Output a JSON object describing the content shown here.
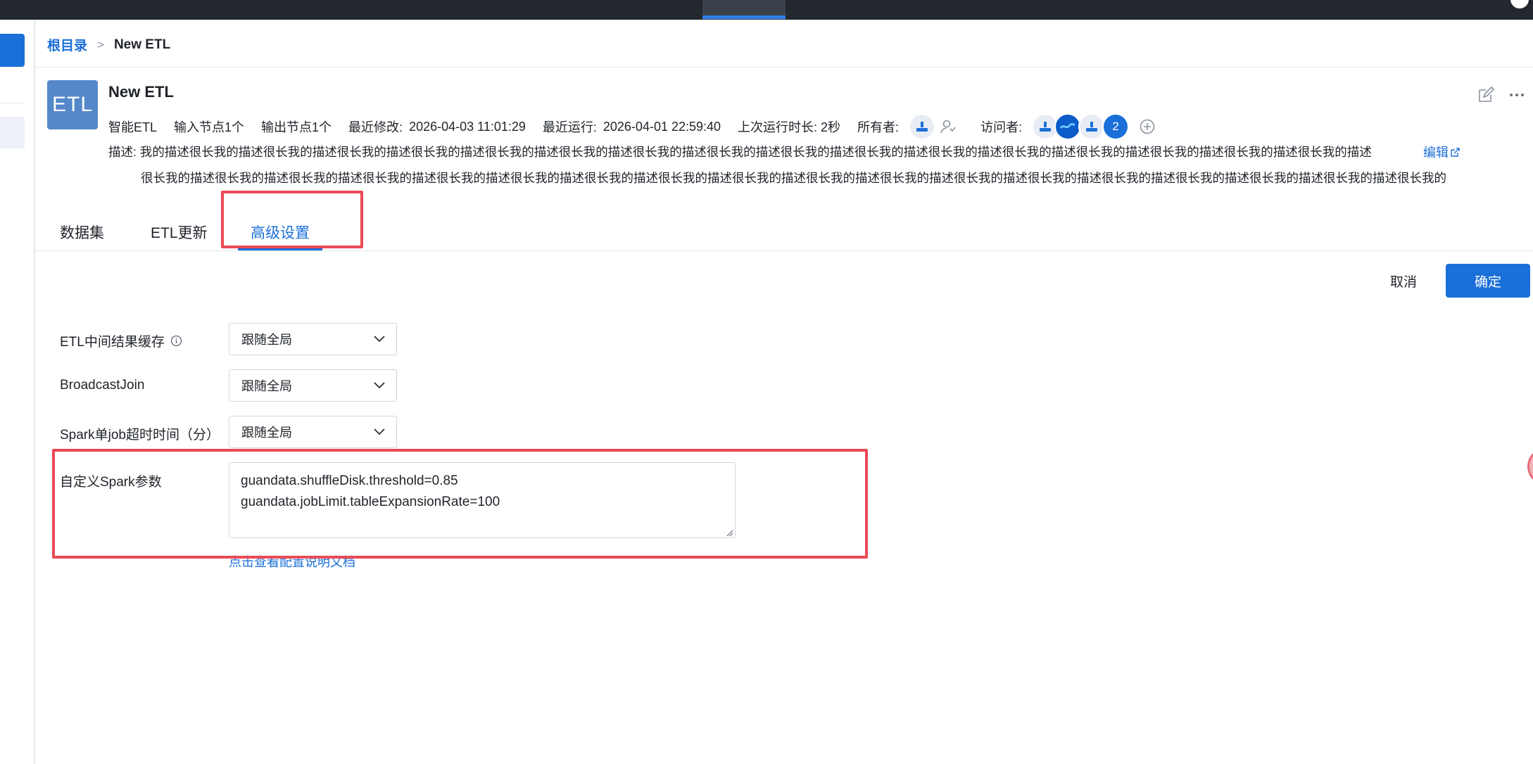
{
  "breadcrumb": {
    "root": "根目录",
    "separator": ">",
    "current": "New ETL"
  },
  "etl": {
    "logo_text": "ETL",
    "title": "New ETL",
    "meta": {
      "type": "智能ETL",
      "inputs": "输入节点1个",
      "outputs": "输出节点1个",
      "modified_label": "最近修改:",
      "modified_value": "2026-04-03 11:01:29",
      "run_label": "最近运行:",
      "run_value": "2026-04-01 22:59:40",
      "duration": "上次运行时长: 2秒",
      "owner_label": "所有者:",
      "visitor_label": "访问者:",
      "visitor_more_count": "2"
    },
    "description_line1": "描述: 我的描述很长我的描述很长我的描述很长我的描述很长我的描述很长我的描述很长我的描述很长我的描述很长我的描述很长我的描述很长我的描述很长我的描述很长我的描述很长我的描述很长我的描述很长我的描述很长我的描述",
    "description_line2": "很长我的描述很长我的描述很长我的描述很长我的描述很长我的描述很长我的描述很长我的描述很长我的描述很长我的描述很长我的描述很长我的描述很长我的描述很长我的描述很长我的描述很长我的描述很长我的描述很长我的描述很长我的",
    "edit_label": "编辑"
  },
  "tabs": [
    {
      "label": "数据集",
      "active": false
    },
    {
      "label": "ETL更新",
      "active": false
    },
    {
      "label": "高级设置",
      "active": true
    }
  ],
  "actions": {
    "cancel": "取消",
    "confirm": "确定"
  },
  "form": {
    "cache_label": "ETL中间结果缓存",
    "cache_value": "跟随全局",
    "broadcast_label": "BroadcastJoin",
    "broadcast_value": "跟随全局",
    "timeout_label": "Spark单job超时时间（分）",
    "timeout_value": "跟随全局",
    "custom_label": "自定义Spark参数",
    "custom_line1": "guandata.shuffleDisk.threshold=0.85",
    "custom_line2": "guandata.jobLimit.tableExpansionRate=100",
    "doc_link": "点击查看配置说明文档"
  },
  "colors": {
    "accent": "#1b6fd8",
    "highlight": "#ea4a55",
    "logo_bg": "#5488c9"
  }
}
